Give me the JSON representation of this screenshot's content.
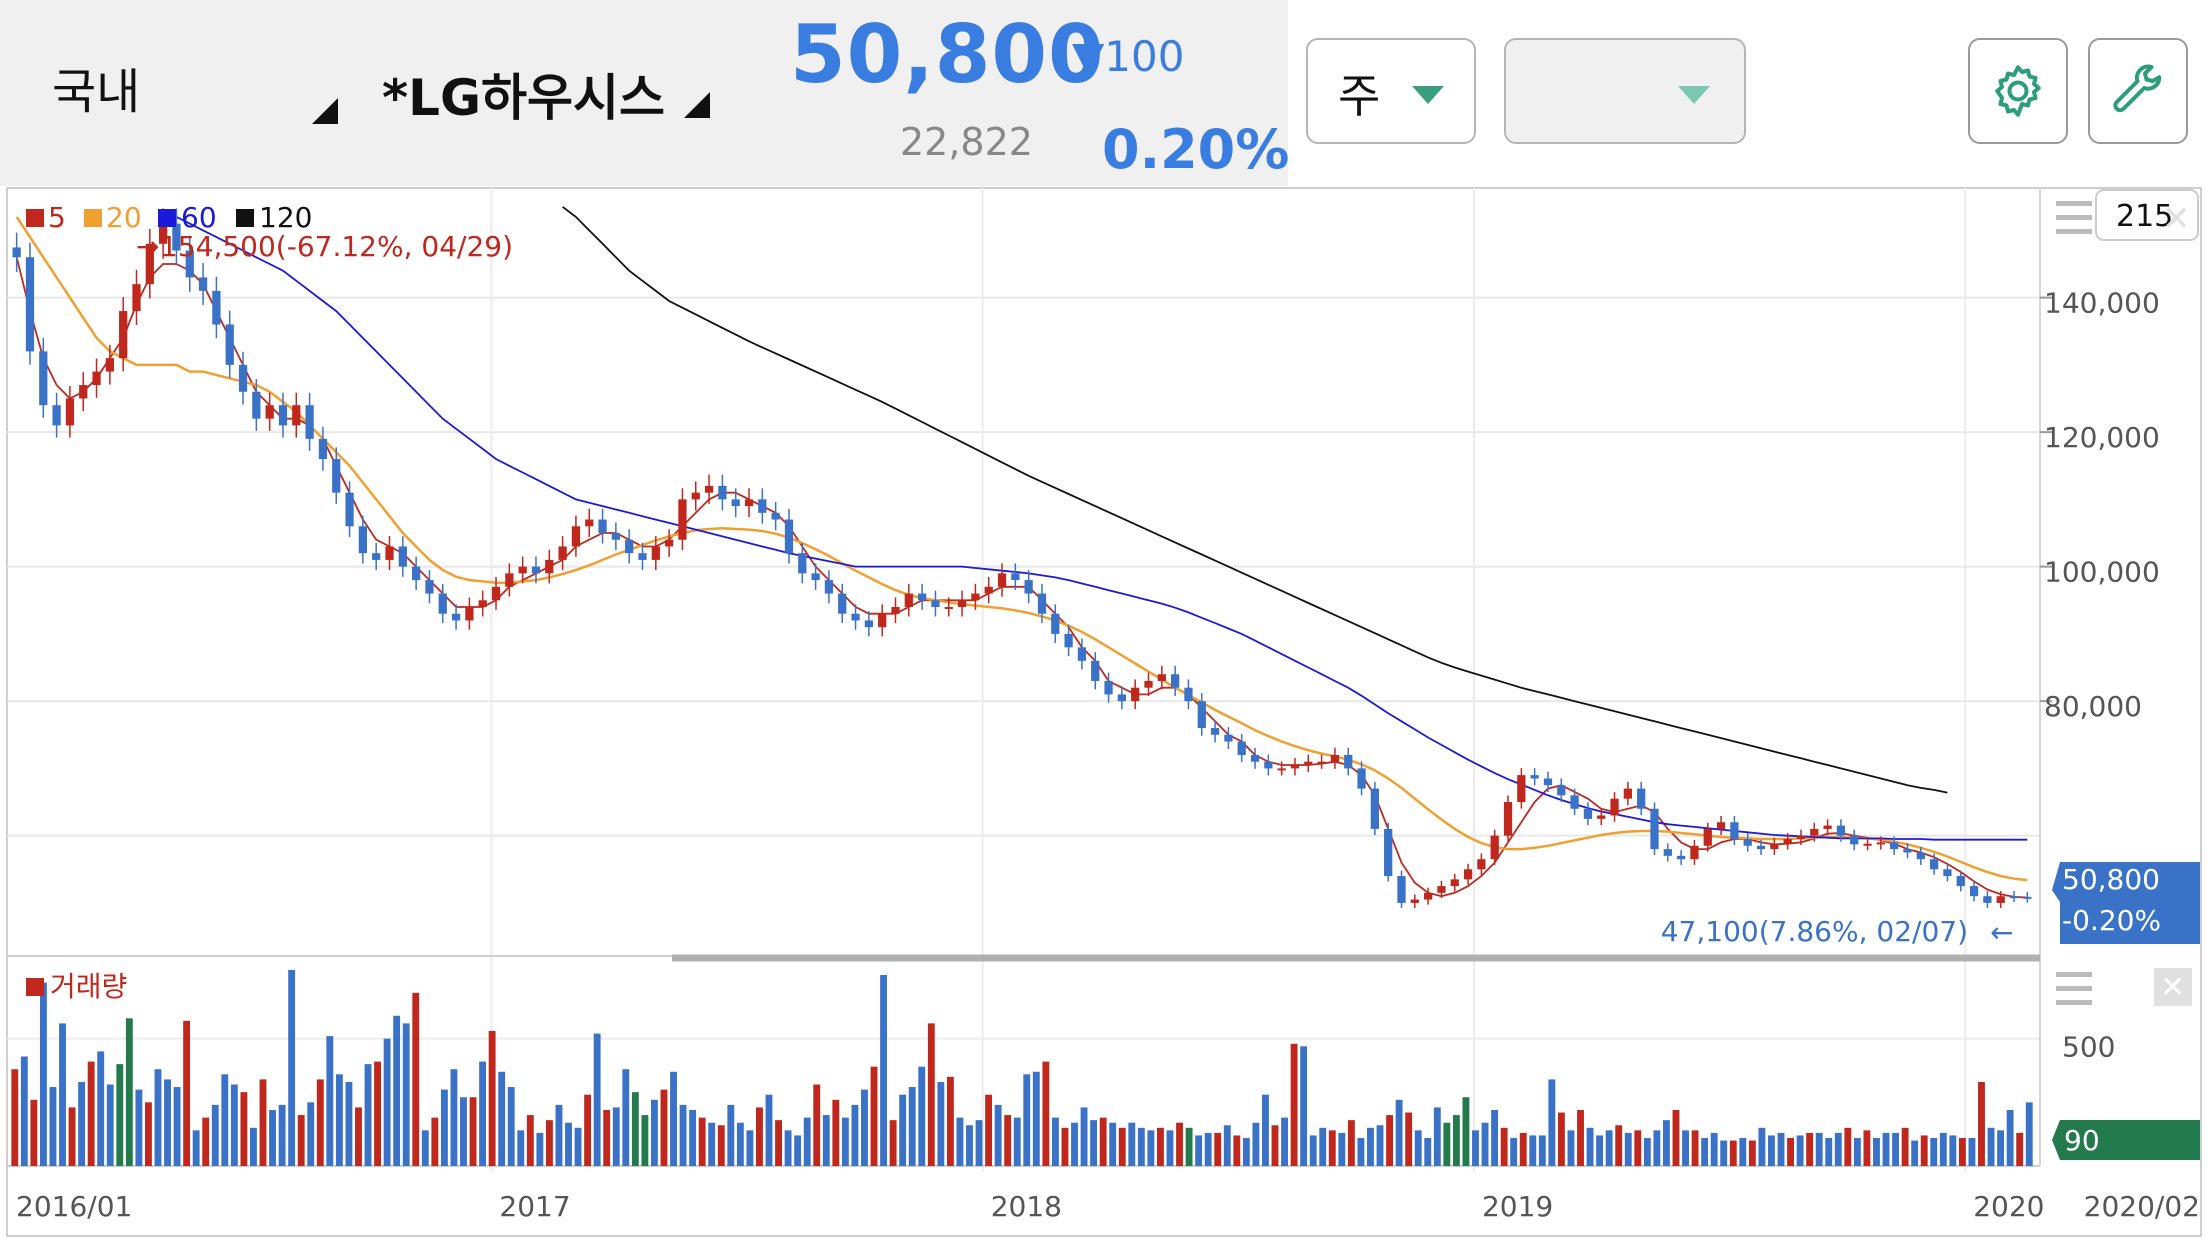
{
  "header": {
    "market": "국내",
    "stock": "*LG하우시스",
    "price": "50,800",
    "change": "▼100",
    "volume": "22,822",
    "change_pct": "0.20%",
    "period_select": "주",
    "second_select": ""
  },
  "icons": {
    "settings": "gear-icon",
    "tools": "wrench-icon"
  },
  "colors": {
    "up": "#c0281e",
    "down": "#3a72c8",
    "ma5": "#c0281e",
    "ma20": "#f0a030",
    "ma60": "#1a1ad8",
    "ma120": "#111111",
    "accent": "#3a7de0",
    "volume_tag": "#237a4d"
  },
  "chart_data": {
    "type": "candlestick",
    "period": "weekly",
    "legend": [
      "5",
      "20",
      "60",
      "120"
    ],
    "visible_count": "215",
    "y_ticks": [
      "140,000",
      "120,000",
      "100,000",
      "80,000"
    ],
    "ylim": [
      43000,
      156000
    ],
    "x_labels": [
      "2016/01",
      "2017",
      "2018",
      "2019",
      "2020",
      "2020/02"
    ],
    "x_label_dates": [
      2016.0,
      2016.98,
      2017.98,
      2018.98,
      2019.98,
      2020.12
    ],
    "x_range": [
      2016.0,
      2020.12
    ],
    "high_annotation": {
      "text": "154,500(-67.12%, 04/29)",
      "arrow": "→",
      "value": 154500
    },
    "low_annotation": {
      "text": "47,100(7.86%, 02/07)",
      "arrow": "←",
      "value": 47100
    },
    "last_price_tag": {
      "price": "50,800",
      "pct": "-0.20%"
    },
    "close_series": [
      146000,
      132000,
      124000,
      121000,
      125000,
      127000,
      129000,
      131000,
      138000,
      142000,
      148000,
      151000,
      147000,
      143000,
      141000,
      136000,
      130000,
      126000,
      122000,
      124000,
      121000,
      124000,
      119000,
      116000,
      111000,
      106000,
      102000,
      101000,
      103000,
      100000,
      98000,
      96000,
      93000,
      92000,
      94000,
      95000,
      97000,
      99000,
      100000,
      99000,
      101000,
      103000,
      106000,
      107000,
      105000,
      104000,
      102000,
      101000,
      103000,
      104000,
      110000,
      111000,
      112000,
      110000,
      109000,
      110000,
      108000,
      107000,
      102000,
      99000,
      98000,
      96000,
      93000,
      92000,
      91000,
      93000,
      94000,
      96000,
      95000,
      94000,
      94000,
      95000,
      96000,
      97000,
      99000,
      98000,
      96000,
      93000,
      90000,
      88000,
      86000,
      83000,
      81000,
      80000,
      82000,
      83000,
      84000,
      82000,
      80000,
      76000,
      75000,
      74000,
      72000,
      71000,
      70000,
      70000,
      70500,
      71000,
      71000,
      72000,
      70000,
      67000,
      61000,
      54000,
      50000,
      50500,
      51500,
      52500,
      53500,
      55000,
      56500,
      60000,
      65000,
      69000,
      68500,
      67500,
      66000,
      64000,
      62500,
      63000,
      65500,
      67000,
      64000,
      58000,
      57000,
      56500,
      58500,
      61000,
      62000,
      59500,
      58500,
      58000,
      58800,
      59500,
      60000,
      61000,
      61500,
      60000,
      58700,
      58800,
      59000,
      58000,
      57500,
      56500,
      55000,
      54000,
      52500,
      51000,
      50000,
      51000,
      50900,
      50800
    ],
    "series": [
      {
        "name": "5",
        "values": [
          146000,
          138000,
          131000,
          127000,
          125000,
          126000,
          128000,
          131000,
          134000,
          139000,
          143000,
          145000,
          145000,
          144000,
          142000,
          138000,
          134000,
          130000,
          126000,
          124000,
          122000,
          122000,
          121000,
          119000,
          115000,
          111000,
          107000,
          104000,
          103000,
          102000,
          100000,
          98000,
          96000,
          94000,
          94000,
          94000,
          95000,
          97000,
          98000,
          99000,
          100000,
          101000,
          103000,
          104000,
          105000,
          105000,
          104000,
          103000,
          103000,
          104000,
          106000,
          108000,
          110000,
          111000,
          111000,
          110000,
          109000,
          108000,
          106000,
          103000,
          100000,
          98000,
          96000,
          94000,
          93000,
          93000,
          93000,
          94000,
          95000,
          95000,
          95000,
          95000,
          95000,
          96000,
          97000,
          97000,
          97000,
          95000,
          93000,
          91000,
          88000,
          86000,
          83000,
          82000,
          81000,
          81000,
          82000,
          82000,
          81000,
          79000,
          77000,
          75000,
          74000,
          72000,
          71000,
          70500,
          70500,
          70500,
          70700,
          71000,
          70500,
          69000,
          66000,
          61000,
          56000,
          53000,
          51500,
          51000,
          51500,
          52500,
          54000,
          56000,
          59000,
          62000,
          65000,
          67000,
          67500,
          66500,
          65500,
          64000,
          63500,
          64000,
          64500,
          63500,
          61000,
          59000,
          58000,
          58000,
          59000,
          59500,
          59500,
          59000,
          58700,
          58800,
          59000,
          59600,
          60300,
          60400,
          60000,
          59700,
          59300,
          58800,
          58000,
          57500,
          56800,
          55800,
          54600,
          53200,
          52000,
          51300,
          50900,
          50800
        ]
      },
      {
        "name": "20",
        "values": [
          152000,
          149000,
          146000,
          143000,
          140000,
          137000,
          134000,
          132000,
          131000,
          130000,
          130000,
          130000,
          130000,
          129000,
          129000,
          128500,
          128000,
          127500,
          127000,
          126000,
          124500,
          123000,
          121000,
          119000,
          117000,
          115000,
          112500,
          110000,
          107500,
          105000,
          103000,
          101000,
          99500,
          98500,
          98000,
          97800,
          97600,
          97600,
          97800,
          98000,
          98400,
          98900,
          99500,
          100200,
          101000,
          101800,
          102500,
          103200,
          103900,
          104500,
          105000,
          105400,
          105600,
          105700,
          105600,
          105500,
          105300,
          104900,
          104300,
          103500,
          102600,
          101600,
          100500,
          99400,
          98400,
          97400,
          96500,
          95800,
          95300,
          95000,
          94700,
          94400,
          94200,
          94000,
          93800,
          93500,
          93100,
          92600,
          92000,
          91200,
          90300,
          89200,
          88000,
          86800,
          85600,
          84400,
          83200,
          82000,
          80900,
          79800,
          78700,
          77700,
          76700,
          75700,
          74800,
          74000,
          73300,
          72700,
          72200,
          71800,
          71300,
          70600,
          69700,
          68500,
          67100,
          65500,
          63900,
          62400,
          61000,
          59800,
          58900,
          58300,
          58000,
          58000,
          58200,
          58500,
          58900,
          59300,
          59700,
          60100,
          60400,
          60600,
          60700,
          60700,
          60600,
          60400,
          60200,
          60000,
          59800,
          59700,
          59600,
          59500,
          59500,
          59500,
          59600,
          59700,
          59800,
          59800,
          59700,
          59600,
          59400,
          59100,
          58700,
          58200,
          57600,
          56900,
          56100,
          55300,
          54600,
          54000,
          53600,
          53400
        ]
      },
      {
        "name": "60",
        "values": [
          null,
          null,
          null,
          null,
          null,
          null,
          null,
          null,
          null,
          null,
          null,
          null,
          152000,
          151000,
          150000,
          149000,
          148000,
          147000,
          146000,
          145000,
          144000,
          142500,
          141000,
          139500,
          138000,
          136000,
          134000,
          132000,
          130000,
          128000,
          126000,
          124000,
          122000,
          120500,
          119000,
          117500,
          116000,
          115000,
          114000,
          113000,
          112000,
          111000,
          110000,
          109500,
          109000,
          108500,
          108000,
          107500,
          107000,
          106500,
          106000,
          105500,
          105000,
          104500,
          104000,
          103500,
          103000,
          102500,
          102000,
          101600,
          101200,
          100800,
          100400,
          100000,
          100000,
          100000,
          100000,
          100000,
          100000,
          100000,
          100000,
          100000,
          99800,
          99600,
          99400,
          99200,
          99000,
          98700,
          98400,
          98000,
          97500,
          97000,
          96500,
          96000,
          95500,
          95000,
          94500,
          93900,
          93200,
          92400,
          91600,
          90800,
          90000,
          89000,
          88000,
          87000,
          86000,
          85000,
          84000,
          83000,
          82000,
          80800,
          79500,
          78200,
          77000,
          75800,
          74600,
          73500,
          72400,
          71300,
          70300,
          69300,
          68400,
          67600,
          66800,
          66000,
          65300,
          64700,
          64100,
          63600,
          63200,
          62800,
          62400,
          62000,
          61700,
          61500,
          61300,
          61100,
          60900,
          60700,
          60500,
          60300,
          60100,
          60000,
          59900,
          59800,
          59700,
          59600,
          59600,
          59600,
          59600,
          59500,
          59500,
          59500,
          59400,
          59400,
          59400,
          59400,
          59400,
          59400,
          59400,
          59400
        ]
      },
      {
        "name": "120",
        "values": [
          null,
          null,
          null,
          null,
          null,
          null,
          null,
          null,
          null,
          null,
          null,
          null,
          null,
          null,
          null,
          null,
          null,
          null,
          null,
          null,
          null,
          null,
          null,
          null,
          null,
          null,
          null,
          null,
          null,
          null,
          null,
          null,
          null,
          null,
          null,
          null,
          null,
          null,
          null,
          null,
          null,
          153500,
          152000,
          150000,
          148000,
          146000,
          144000,
          142500,
          141000,
          139500,
          138500,
          137500,
          136500,
          135500,
          134500,
          133500,
          132600,
          131700,
          130800,
          129900,
          129000,
          128100,
          127200,
          126300,
          125400,
          124500,
          123500,
          122500,
          121500,
          120500,
          119500,
          118500,
          117500,
          116500,
          115500,
          114500,
          113500,
          112600,
          111700,
          110800,
          109900,
          109000,
          108100,
          107200,
          106300,
          105400,
          104500,
          103600,
          102700,
          101800,
          100900,
          100000,
          99100,
          98200,
          97300,
          96400,
          95500,
          94600,
          93700,
          92800,
          91900,
          91000,
          90100,
          89200,
          88300,
          87400,
          86500,
          85700,
          85000,
          84400,
          83800,
          83200,
          82600,
          82000,
          81500,
          81000,
          80500,
          80000,
          79500,
          79000,
          78500,
          78000,
          77500,
          77000,
          76500,
          76000,
          75500,
          75000,
          74500,
          74000,
          73500,
          73000,
          72500,
          72000,
          71500,
          71000,
          70500,
          70000,
          69500,
          69000,
          68500,
          68000,
          67500,
          67100,
          66800,
          66400
        ]
      }
    ],
    "volume": {
      "label": "거래량",
      "y_ticks": [
        "500"
      ],
      "ylim": [
        0,
        750
      ],
      "last_value": "90",
      "values": [
        380,
        430,
        260,
        720,
        310,
        560,
        230,
        330,
        410,
        450,
        320,
        400,
        580,
        300,
        250,
        380,
        340,
        310,
        570,
        140,
        190,
        240,
        360,
        320,
        290,
        150,
        340,
        220,
        240,
        770,
        200,
        250,
        340,
        510,
        360,
        330,
        230,
        400,
        410,
        500,
        590,
        560,
        680,
        140,
        190,
        300,
        380,
        270,
        270,
        410,
        530,
        370,
        310,
        140,
        200,
        130,
        180,
        240,
        170,
        150,
        280,
        520,
        220,
        230,
        380,
        290,
        200,
        260,
        300,
        370,
        240,
        220,
        190,
        170,
        160,
        240,
        170,
        140,
        230,
        280,
        180,
        140,
        120,
        190,
        320,
        200,
        260,
        190,
        240,
        300,
        390,
        750,
        180,
        280,
        310,
        390,
        560,
        330,
        350,
        190,
        160,
        180,
        280,
        240,
        200,
        190,
        360,
        370,
        410,
        190,
        150,
        170,
        230,
        180,
        190,
        170,
        150,
        170,
        150,
        140,
        150,
        140,
        170,
        150,
        120,
        130,
        130,
        160,
        120,
        110,
        170,
        280,
        160,
        190,
        480,
        470,
        120,
        150,
        140,
        130,
        180,
        110,
        150,
        160,
        200,
        260,
        210,
        140,
        110,
        230,
        170,
        200,
        270,
        140,
        170,
        220,
        150,
        110,
        130,
        120,
        120,
        340,
        210,
        140,
        220,
        150,
        120,
        140,
        160,
        130,
        140,
        110,
        140,
        180,
        220,
        140,
        140,
        110,
        130,
        100,
        100,
        110,
        100,
        150,
        120,
        130,
        110,
        120,
        130,
        130,
        110,
        130,
        150,
        110,
        140,
        110,
        130,
        130,
        150,
        100,
        120,
        110,
        130,
        120,
        110,
        110,
        330,
        150,
        140,
        220,
        130,
        250
      ]
    }
  }
}
